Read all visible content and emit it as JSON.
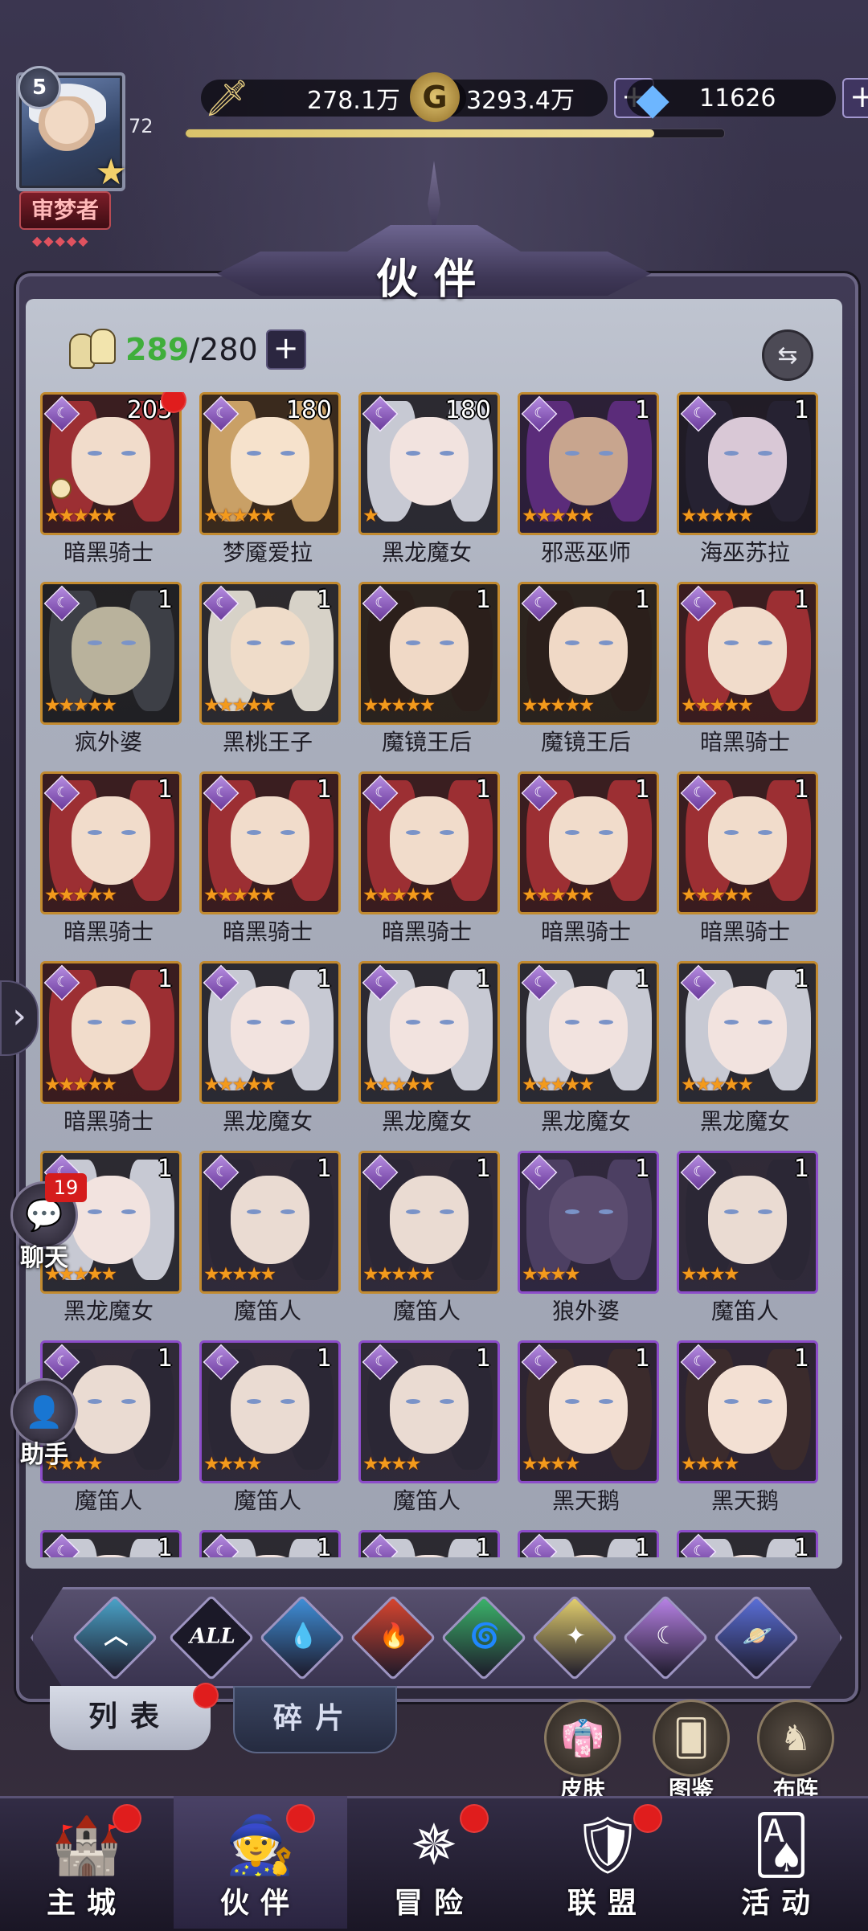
{
  "player": {
    "level": "5",
    "exp_num": "72",
    "exp_progress_pct": 87,
    "title": "审梦者",
    "title_diamonds": "◆◆◆◆◆"
  },
  "resources": {
    "power": "278.1万",
    "gold": "3293.4万",
    "gems": "11626"
  },
  "header": {
    "title": "伙伴"
  },
  "partners": {
    "owned": "289",
    "slash": "/",
    "capacity": "280"
  },
  "colors": {
    "gold_border": "#c28a2f",
    "purple_border": "#8c4cc9",
    "owned_count": "#3fae3b",
    "star": "#f39a1c"
  },
  "heroes": [
    {
      "name": "暗黑骑士",
      "level": "205",
      "stars": 5,
      "frame": "gold",
      "portrait": "red-hair",
      "red_dot": true,
      "lock": true
    },
    {
      "name": "梦魇爱拉",
      "level": "180",
      "stars": 5,
      "frame": "gold",
      "portrait": "blonde",
      "red_dot": false
    },
    {
      "name": "黑龙魔女",
      "level": "180",
      "stars": 1,
      "frame": "gold",
      "portrait": "silver-hair",
      "red_dot": false
    },
    {
      "name": "邪恶巫师",
      "level": "1",
      "stars": 5,
      "frame": "gold",
      "portrait": "wizard",
      "red_dot": false
    },
    {
      "name": "海巫苏拉",
      "level": "1",
      "stars": 5,
      "frame": "gold",
      "portrait": "sea-witch",
      "red_dot": false
    },
    {
      "name": "疯外婆",
      "level": "1",
      "stars": 5,
      "frame": "gold",
      "portrait": "old-woman",
      "red_dot": false
    },
    {
      "name": "黑桃王子",
      "level": "1",
      "stars": 5,
      "frame": "gold",
      "portrait": "prince",
      "red_dot": false
    },
    {
      "name": "魔镜王后",
      "level": "1",
      "stars": 5,
      "frame": "gold",
      "portrait": "queen",
      "red_dot": false
    },
    {
      "name": "魔镜王后",
      "level": "1",
      "stars": 5,
      "frame": "gold",
      "portrait": "queen",
      "red_dot": false
    },
    {
      "name": "暗黑骑士",
      "level": "1",
      "stars": 5,
      "frame": "gold",
      "portrait": "red-hair",
      "red_dot": false
    },
    {
      "name": "暗黑骑士",
      "level": "1",
      "stars": 5,
      "frame": "gold",
      "portrait": "red-hair",
      "red_dot": false
    },
    {
      "name": "暗黑骑士",
      "level": "1",
      "stars": 5,
      "frame": "gold",
      "portrait": "red-hair",
      "red_dot": false
    },
    {
      "name": "暗黑骑士",
      "level": "1",
      "stars": 5,
      "frame": "gold",
      "portrait": "red-hair",
      "red_dot": false
    },
    {
      "name": "暗黑骑士",
      "level": "1",
      "stars": 5,
      "frame": "gold",
      "portrait": "red-hair",
      "red_dot": false
    },
    {
      "name": "暗黑骑士",
      "level": "1",
      "stars": 5,
      "frame": "gold",
      "portrait": "red-hair",
      "red_dot": false
    },
    {
      "name": "暗黑骑士",
      "level": "1",
      "stars": 5,
      "frame": "gold",
      "portrait": "red-hair",
      "red_dot": false
    },
    {
      "name": "黑龙魔女",
      "level": "1",
      "stars": 5,
      "frame": "gold",
      "portrait": "silver-hair",
      "red_dot": false
    },
    {
      "name": "黑龙魔女",
      "level": "1",
      "stars": 5,
      "frame": "gold",
      "portrait": "silver-hair",
      "red_dot": false
    },
    {
      "name": "黑龙魔女",
      "level": "1",
      "stars": 5,
      "frame": "gold",
      "portrait": "silver-hair",
      "red_dot": false
    },
    {
      "name": "黑龙魔女",
      "level": "1",
      "stars": 5,
      "frame": "gold",
      "portrait": "silver-hair",
      "red_dot": false
    },
    {
      "name": "黑龙魔女",
      "level": "1",
      "stars": 5,
      "frame": "gold",
      "portrait": "silver-hair",
      "red_dot": false
    },
    {
      "name": "魔笛人",
      "level": "1",
      "stars": 5,
      "frame": "gold",
      "portrait": "masked",
      "red_dot": false
    },
    {
      "name": "魔笛人",
      "level": "1",
      "stars": 5,
      "frame": "gold",
      "portrait": "masked",
      "red_dot": false
    },
    {
      "name": "狼外婆",
      "level": "1",
      "stars": 4,
      "frame": "purple",
      "portrait": "wolf",
      "red_dot": false
    },
    {
      "name": "魔笛人",
      "level": "1",
      "stars": 4,
      "frame": "purple",
      "portrait": "masked",
      "red_dot": false
    },
    {
      "name": "魔笛人",
      "level": "1",
      "stars": 4,
      "frame": "purple",
      "portrait": "masked",
      "red_dot": false
    },
    {
      "name": "魔笛人",
      "level": "1",
      "stars": 4,
      "frame": "purple",
      "portrait": "masked",
      "red_dot": false
    },
    {
      "name": "魔笛人",
      "level": "1",
      "stars": 4,
      "frame": "purple",
      "portrait": "masked",
      "red_dot": false
    },
    {
      "name": "黑天鹅",
      "level": "1",
      "stars": 4,
      "frame": "purple",
      "portrait": "swan",
      "red_dot": false
    },
    {
      "name": "黑天鹅",
      "level": "1",
      "stars": 4,
      "frame": "purple",
      "portrait": "swan",
      "red_dot": false
    },
    {
      "name": "",
      "level": "1",
      "stars": 0,
      "frame": "purple",
      "portrait": "silver-hair",
      "red_dot": false
    },
    {
      "name": "",
      "level": "1",
      "stars": 0,
      "frame": "purple",
      "portrait": "silver-hair",
      "red_dot": false
    },
    {
      "name": "",
      "level": "1",
      "stars": 0,
      "frame": "purple",
      "portrait": "silver-hair",
      "red_dot": false
    },
    {
      "name": "",
      "level": "1",
      "stars": 0,
      "frame": "purple",
      "portrait": "silver-hair",
      "red_dot": false
    },
    {
      "name": "",
      "level": "1",
      "stars": 0,
      "frame": "purple",
      "portrait": "silver-hair",
      "red_dot": false
    }
  ],
  "filters": [
    {
      "id": "origin",
      "label": "",
      "icon": "chevron-up-icon",
      "color": "#4aa3c8"
    },
    {
      "id": "all",
      "label": "ALL",
      "icon": "",
      "color": "#1b1928"
    },
    {
      "id": "water",
      "label": "",
      "icon": "water-drop-icon",
      "color": "#3f8fd8"
    },
    {
      "id": "fire",
      "label": "",
      "icon": "fire-icon",
      "color": "#d8452f"
    },
    {
      "id": "wind",
      "label": "",
      "icon": "wind-icon",
      "color": "#3bb36a"
    },
    {
      "id": "light",
      "label": "",
      "icon": "sun-icon",
      "color": "#e3cf6e"
    },
    {
      "id": "dark",
      "label": "",
      "icon": "moon-icon",
      "color": "#b882e6"
    },
    {
      "id": "cosmic",
      "label": "",
      "icon": "planet-icon",
      "color": "#5a6fd8"
    }
  ],
  "subtabs": {
    "list": "列表",
    "fragments": "碎片"
  },
  "quick_actions": {
    "skin": "皮肤",
    "codex": "图鉴",
    "formation": "布阵"
  },
  "side": {
    "chat": "聊天",
    "chat_badge": "19",
    "assistant": "助手"
  },
  "nav": [
    {
      "label": "主城",
      "icon": "castle-icon",
      "active": false,
      "red_dot": true
    },
    {
      "label": "伙伴",
      "icon": "witch-hat-icon",
      "active": true,
      "red_dot": true
    },
    {
      "label": "冒险",
      "icon": "compass-icon",
      "active": false,
      "red_dot": true
    },
    {
      "label": "联盟",
      "icon": "shield-icon",
      "active": false,
      "red_dot": true
    },
    {
      "label": "活动",
      "icon": "cards-icon",
      "active": false,
      "red_dot": false
    }
  ]
}
